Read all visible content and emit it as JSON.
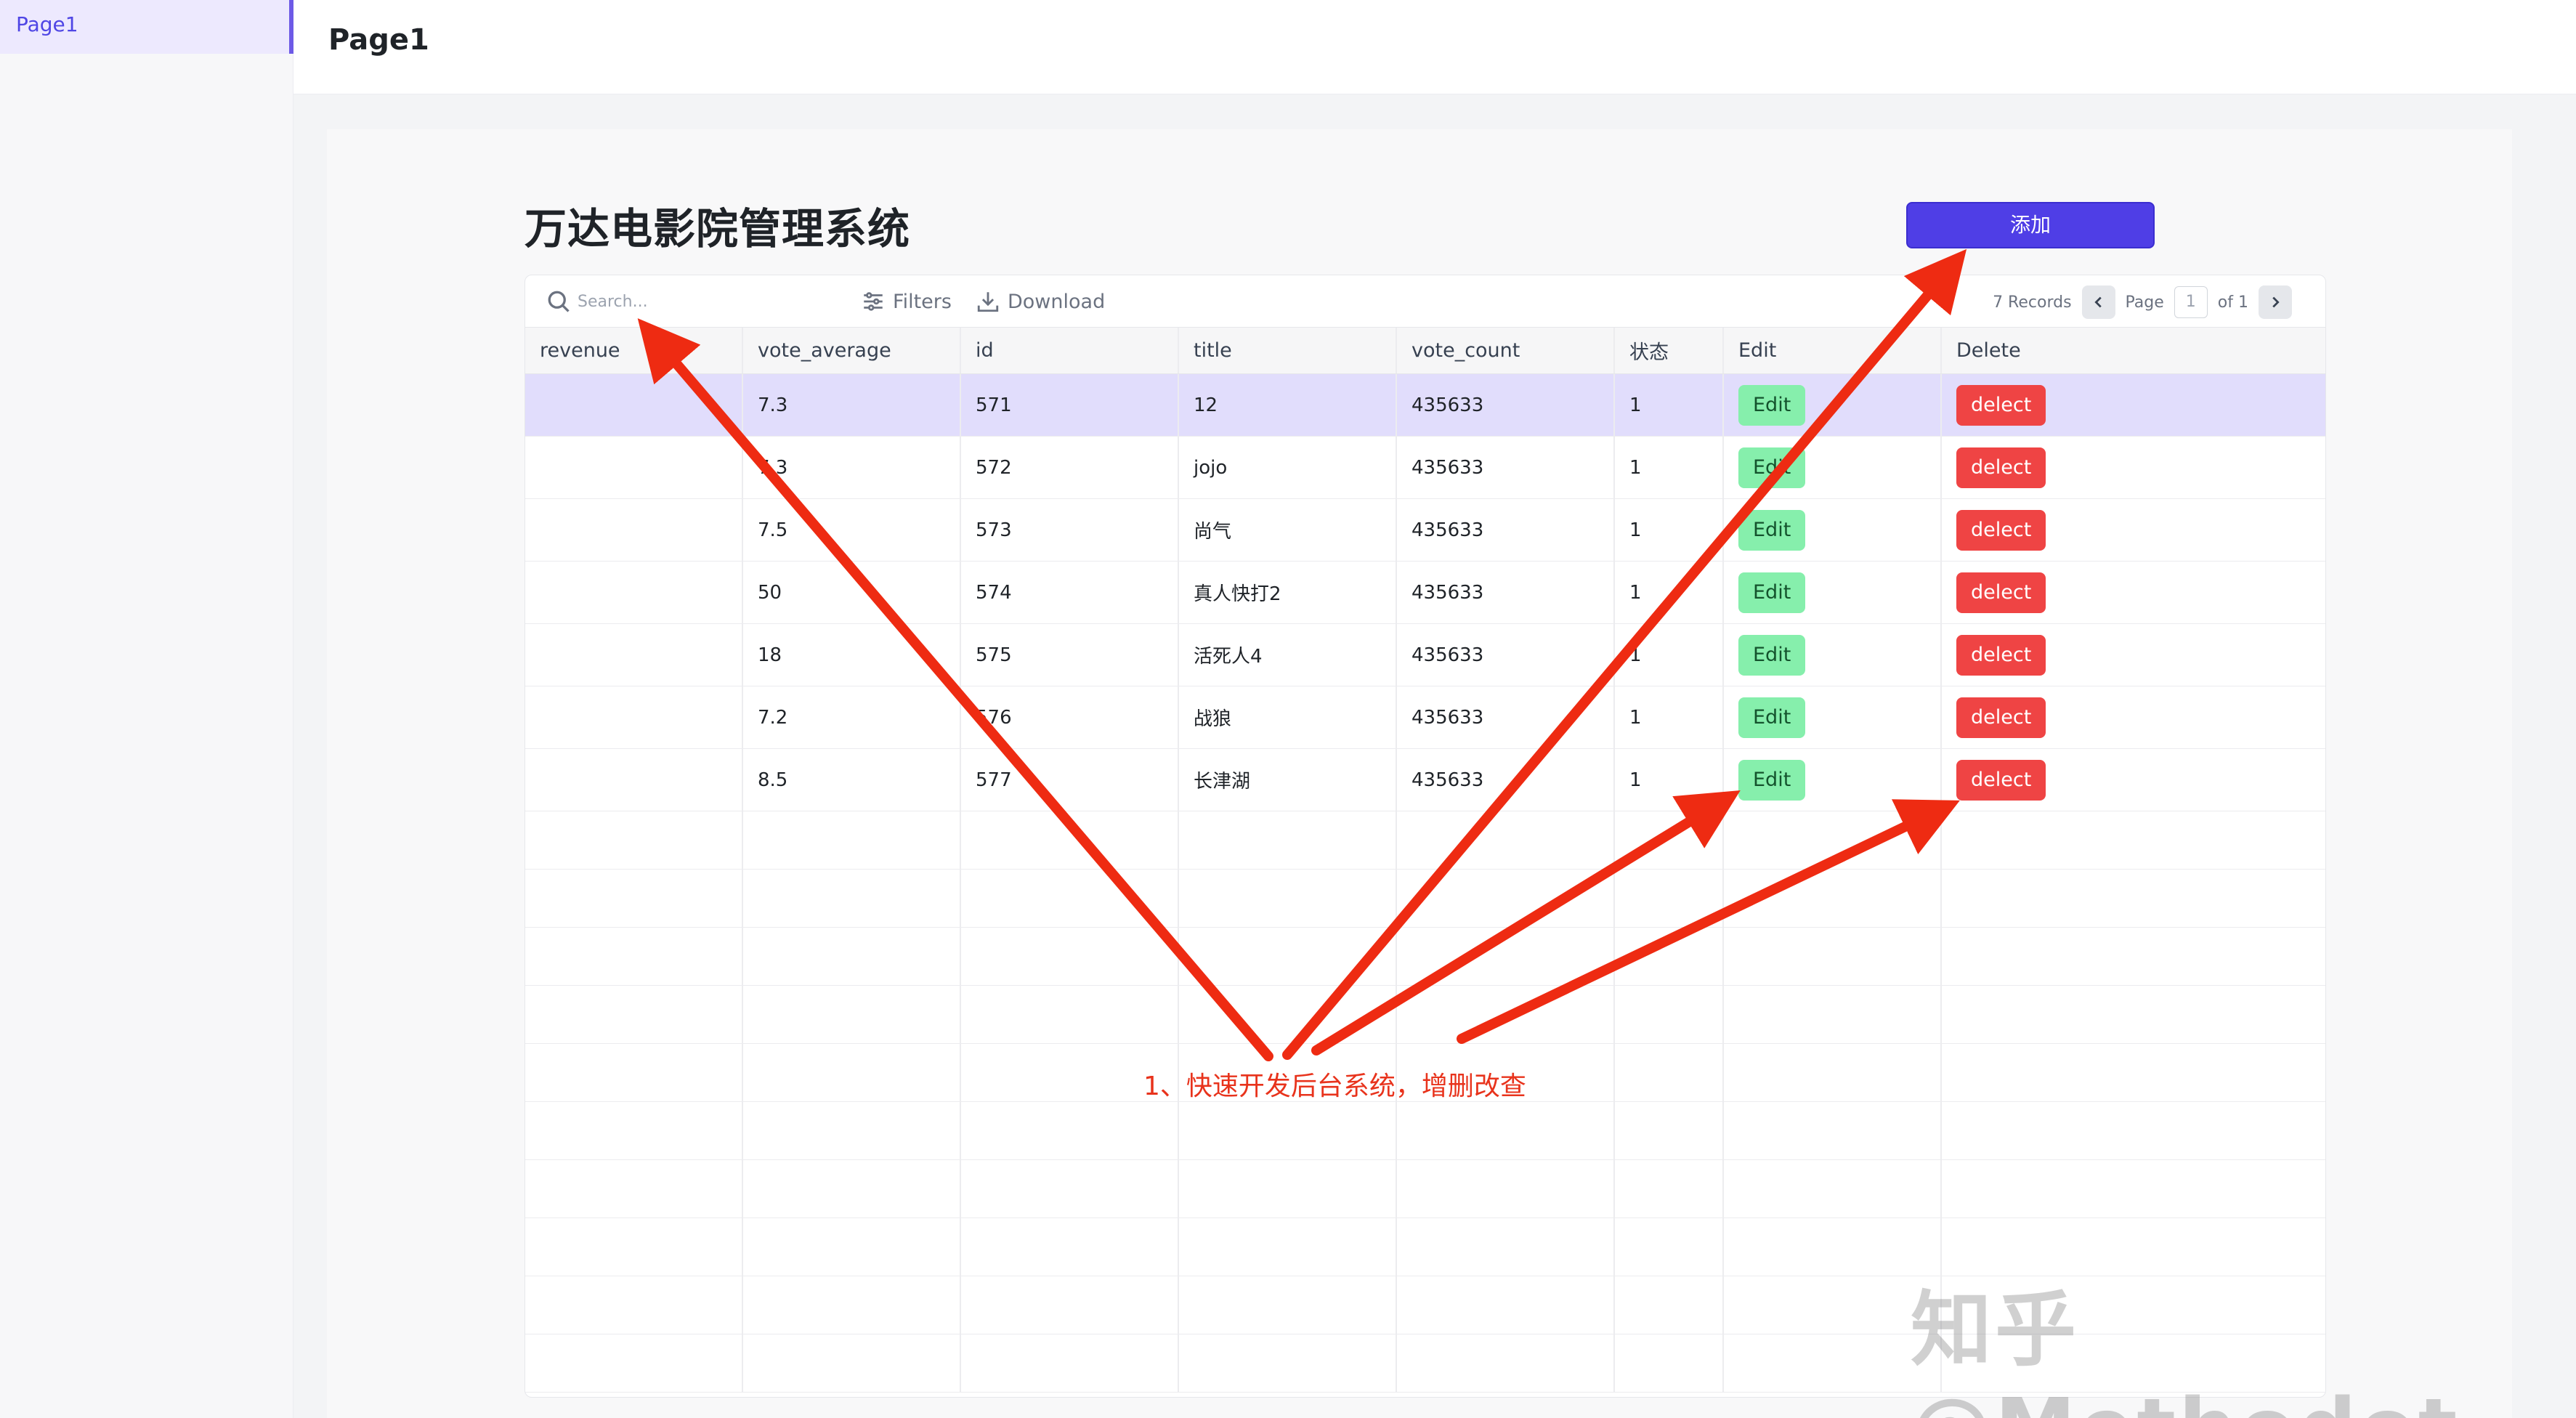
{
  "sidebar": {
    "items": [
      {
        "label": "Page1"
      }
    ]
  },
  "header": {
    "title": "Page1"
  },
  "main": {
    "heading": "万达电影院管理系统",
    "add_label": "添加"
  },
  "toolbar": {
    "search_placeholder": "Search...",
    "filters_label": "Filters",
    "download_label": "Download",
    "records_text": "7 Records",
    "page_label": "Page",
    "page_value": "1",
    "of_text": "of 1"
  },
  "table": {
    "columns": [
      "revenue",
      "vote_average",
      "id",
      "title",
      "vote_count",
      "状态",
      "Edit",
      "Delete"
    ],
    "edit_label": "Edit",
    "delete_label": "delect",
    "rows": [
      {
        "revenue": "",
        "vote_average": "7.3",
        "id": "571",
        "title": "12",
        "vote_count": "435633",
        "status": "1"
      },
      {
        "revenue": "",
        "vote_average": "7.3",
        "id": "572",
        "title": "jojo",
        "vote_count": "435633",
        "status": "1"
      },
      {
        "revenue": "",
        "vote_average": "7.5",
        "id": "573",
        "title": "尚气",
        "vote_count": "435633",
        "status": "1"
      },
      {
        "revenue": "",
        "vote_average": "50",
        "id": "574",
        "title": "真人快打2",
        "vote_count": "435633",
        "status": "1"
      },
      {
        "revenue": "",
        "vote_average": "18",
        "id": "575",
        "title": "活死人4",
        "vote_count": "435633",
        "status": "1"
      },
      {
        "revenue": "",
        "vote_average": "7.2",
        "id": "576",
        "title": "战狼",
        "vote_count": "435633",
        "status": "1"
      },
      {
        "revenue": "",
        "vote_average": "8.5",
        "id": "577",
        "title": "长津湖",
        "vote_count": "435633",
        "status": "1"
      }
    ]
  },
  "annotation": {
    "text": "1、快速开发后台系统，增删改查",
    "color": "#e8331c"
  },
  "watermark": {
    "text": "知乎 @Methodot"
  },
  "colors": {
    "accent": "#4f3ee6",
    "selected_row": "#e1ddfc",
    "edit": "#86efac",
    "delete": "#ef4444"
  }
}
